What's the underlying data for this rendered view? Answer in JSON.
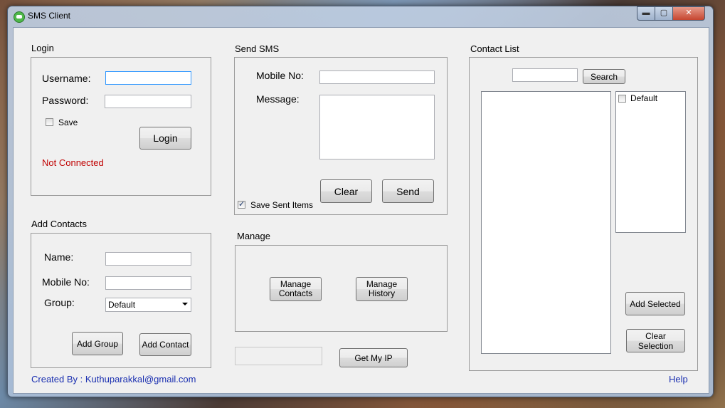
{
  "window": {
    "title": "SMS Client",
    "min_glyph": "▬",
    "max_glyph": "▢",
    "close_glyph": "✕"
  },
  "login": {
    "group_title": "Login",
    "username_label": "Username:",
    "username_value": "",
    "password_label": "Password:",
    "save_label": "Save",
    "login_button": "Login",
    "status": "Not Connected"
  },
  "send_sms": {
    "group_title": "Send SMS",
    "mobile_label": "Mobile No:",
    "message_label": "Message:",
    "clear_button": "Clear",
    "send_button": "Send",
    "save_sent_label": "Save Sent Items",
    "save_sent_checked": true
  },
  "add_contacts": {
    "group_title": "Add Contacts",
    "name_label": "Name:",
    "mobile_label": "Mobile No:",
    "group_label": "Group:",
    "group_selected": "Default",
    "add_group_button": "Add Group",
    "add_contact_button": "Add Contact"
  },
  "manage": {
    "group_title": "Manage",
    "manage_contacts_line1": "Manage",
    "manage_contacts_line2": "Contacts",
    "manage_history_line1": "Manage",
    "manage_history_line2": "History"
  },
  "get_ip_button": "Get My IP",
  "contact_list": {
    "group_title": "Contact List",
    "search_button": "Search",
    "groups": [
      {
        "label": "Default",
        "checked": false
      }
    ],
    "add_selected_button": "Add Selected",
    "clear_selection_button": "Clear Selection"
  },
  "footer": {
    "created_by": "Created By : Kuthuparakkal@gmail.com",
    "help": "Help"
  },
  "colors": {
    "status_red": "#c00000",
    "link_blue": "#1a2fb0"
  }
}
